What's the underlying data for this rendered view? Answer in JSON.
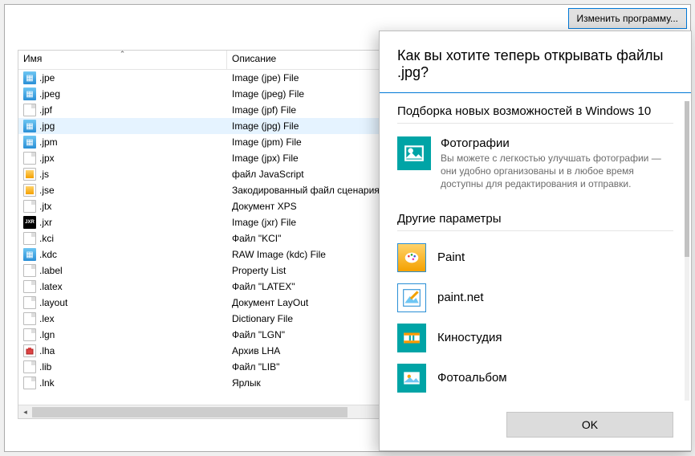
{
  "buttons": {
    "change_program": "Изменить программу...",
    "ok": "OK"
  },
  "columns": {
    "name": "Имя",
    "desc": "Описание"
  },
  "selected_ext": ".jpg",
  "rows": [
    {
      "ext": ".jpe",
      "desc": "Image (jpe) File",
      "icon": "img"
    },
    {
      "ext": ".jpeg",
      "desc": "Image (jpeg) File",
      "icon": "img"
    },
    {
      "ext": ".jpf",
      "desc": "Image (jpf) File",
      "icon": "doc"
    },
    {
      "ext": ".jpg",
      "desc": "Image (jpg) File",
      "icon": "img"
    },
    {
      "ext": ".jpm",
      "desc": "Image (jpm) File",
      "icon": "img"
    },
    {
      "ext": ".jpx",
      "desc": "Image (jpx) File",
      "icon": "doc"
    },
    {
      "ext": ".js",
      "desc": "файл JavaScript",
      "icon": "js"
    },
    {
      "ext": ".jse",
      "desc": "Закодированный файл сценария",
      "icon": "js"
    },
    {
      "ext": ".jtx",
      "desc": "Документ XPS",
      "icon": "doc"
    },
    {
      "ext": ".jxr",
      "desc": "Image (jxr) File",
      "icon": "jxr"
    },
    {
      "ext": ".kci",
      "desc": "Файл \"KCI\"",
      "icon": "doc"
    },
    {
      "ext": ".kdc",
      "desc": "RAW Image (kdc) File",
      "icon": "img"
    },
    {
      "ext": ".label",
      "desc": "Property List",
      "icon": "doc"
    },
    {
      "ext": ".latex",
      "desc": "Файл \"LATEX\"",
      "icon": "doc"
    },
    {
      "ext": ".layout",
      "desc": "Документ LayOut",
      "icon": "doc"
    },
    {
      "ext": ".lex",
      "desc": "Dictionary File",
      "icon": "doc"
    },
    {
      "ext": ".lgn",
      "desc": "Файл \"LGN\"",
      "icon": "doc"
    },
    {
      "ext": ".lha",
      "desc": "Архив LHA",
      "icon": "lha"
    },
    {
      "ext": ".lib",
      "desc": "Файл \"LIB\"",
      "icon": "doc"
    },
    {
      "ext": ".lnk",
      "desc": "Ярлык",
      "icon": "doc"
    }
  ],
  "flyout": {
    "title": "Как вы хотите теперь открывать файлы .jpg?",
    "section1": "Подборка новых возможностей в Windows 10",
    "featured": {
      "name": "Фотографии",
      "sub": "Вы можете с легкостью улучшать фотографии — они удобно организованы и в любое время доступны для редактирования и отправки."
    },
    "section2": "Другие параметры",
    "apps": [
      {
        "name": "Paint",
        "icon": "paint"
      },
      {
        "name": "paint.net",
        "icon": "pdn"
      },
      {
        "name": "Киностудия",
        "icon": "movie"
      },
      {
        "name": "Фотоальбом",
        "icon": "photo"
      }
    ]
  }
}
